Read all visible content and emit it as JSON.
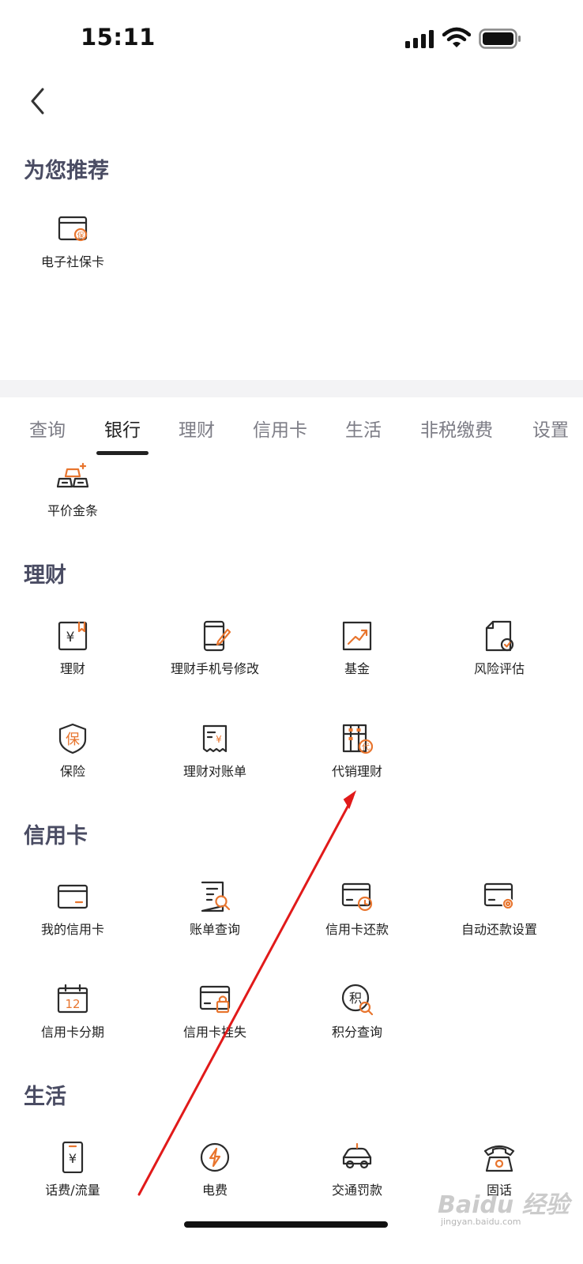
{
  "status_bar": {
    "time": "15:11"
  },
  "recommend": {
    "title": "为您推荐",
    "items": [
      {
        "label": "电子社保卡",
        "icon": "social-security-card-icon",
        "icon_char": "保"
      }
    ]
  },
  "tabs": {
    "items": [
      "查询",
      "银行",
      "理财",
      "信用卡",
      "生活",
      "非税缴费",
      "设置"
    ],
    "active_index": 1
  },
  "bank": {
    "items": [
      {
        "label": "平价金条",
        "icon": "gold-bar-icon"
      }
    ]
  },
  "wealth": {
    "title": "理财",
    "items": [
      {
        "label": "理财",
        "icon": "wealth-icon",
        "icon_char": "¥"
      },
      {
        "label": "理财手机号修改",
        "icon": "phone-edit-icon"
      },
      {
        "label": "基金",
        "icon": "fund-chart-icon"
      },
      {
        "label": "风险评估",
        "icon": "risk-assessment-icon"
      },
      {
        "label": "保险",
        "icon": "insurance-shield-icon",
        "icon_char": "保"
      },
      {
        "label": "理财对账单",
        "icon": "statement-receipt-icon",
        "icon_char": "¥"
      },
      {
        "label": "代销理财",
        "icon": "agency-abacus-icon",
        "icon_char": "代"
      }
    ]
  },
  "credit": {
    "title": "信用卡",
    "items": [
      {
        "label": "我的信用卡",
        "icon": "credit-card-icon"
      },
      {
        "label": "账单查询",
        "icon": "bill-search-icon"
      },
      {
        "label": "信用卡还款",
        "icon": "card-repay-icon"
      },
      {
        "label": "自动还款设置",
        "icon": "card-settings-icon"
      },
      {
        "label": "信用卡分期",
        "icon": "calendar-installment-icon",
        "icon_char": "12"
      },
      {
        "label": "信用卡挂失",
        "icon": "card-lock-icon"
      },
      {
        "label": "积分查询",
        "icon": "points-search-icon",
        "icon_char": "积"
      }
    ]
  },
  "life": {
    "title": "生活",
    "items": [
      {
        "label": "话费/流量",
        "icon": "phone-bill-icon",
        "icon_char": "¥"
      },
      {
        "label": "电费",
        "icon": "electricity-icon"
      },
      {
        "label": "交通罚款",
        "icon": "car-fine-icon"
      },
      {
        "label": "固话",
        "icon": "landline-phone-icon"
      }
    ]
  },
  "watermark": {
    "main": "Baidu 经验",
    "sub": "jingyan.baidu.com"
  },
  "colors": {
    "accent": "#e8752e",
    "icon_stroke": "#2b2b2b",
    "section_title": "#4a4c63",
    "arrow": "#e11a1a"
  }
}
